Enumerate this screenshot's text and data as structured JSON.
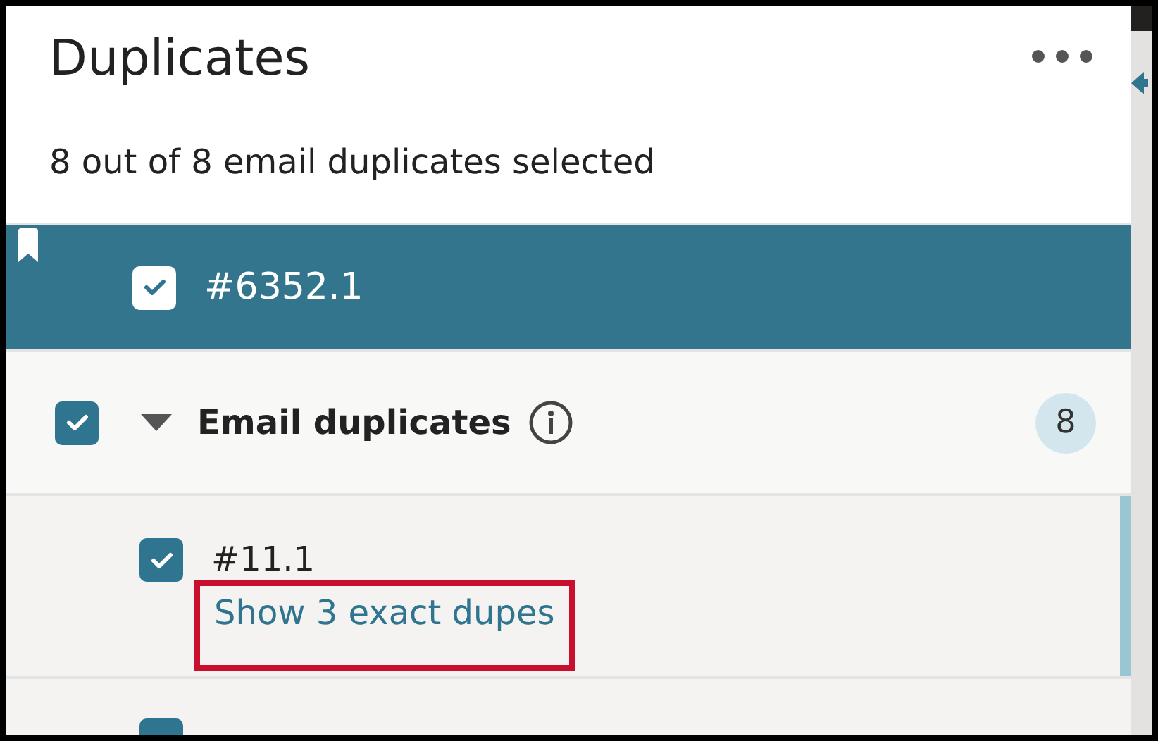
{
  "panel": {
    "title": "Duplicates",
    "summary": "8 out of 8 email duplicates selected"
  },
  "current": {
    "label": "#6352.1",
    "checked": true,
    "selected": true,
    "bookmarked": true
  },
  "group": {
    "label": "Email duplicates",
    "checked": true,
    "expanded": true,
    "count": "8"
  },
  "items": [
    {
      "label": "#11.1",
      "checked": true,
      "link": "Show 3 exact dupes",
      "highlighted": true
    }
  ],
  "partial_rows": [
    {
      "checked": true
    }
  ]
}
